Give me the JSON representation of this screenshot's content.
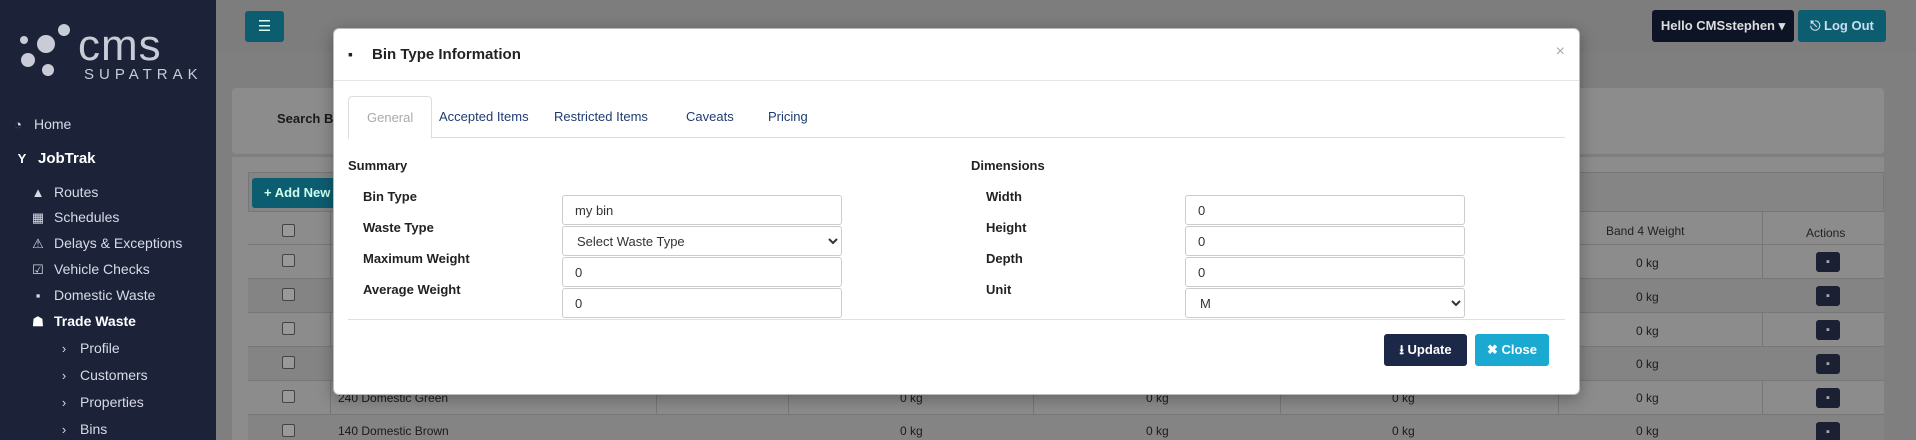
{
  "sidebar": {
    "logo_text": "cms",
    "logo_sub": "SUPATRAK",
    "items": [
      {
        "label": "Home",
        "icon": "dashboard-icon"
      },
      {
        "label": "JobTrak",
        "icon": "jobtrak-icon"
      },
      {
        "label": "Routes",
        "icon": "road-icon"
      },
      {
        "label": "Schedules",
        "icon": "calendar-icon"
      },
      {
        "label": "Delays & Exceptions",
        "icon": "warning-icon"
      },
      {
        "label": "Vehicle Checks",
        "icon": "check-square-icon"
      },
      {
        "label": "Domestic Waste",
        "icon": "bin-icon"
      },
      {
        "label": "Trade Waste",
        "icon": "users-icon"
      },
      {
        "label": "Profile",
        "icon": "chevron-right-icon"
      },
      {
        "label": "Customers",
        "icon": "chevron-right-icon"
      },
      {
        "label": "Properties",
        "icon": "chevron-right-icon"
      },
      {
        "label": "Bins",
        "icon": "chevron-right-icon"
      }
    ]
  },
  "header": {
    "menu_icon": "hamburger-icon",
    "user_label": "Hello CMSstephen",
    "logout_label": "Log Out"
  },
  "page": {
    "search_label": "Search Bi",
    "add_new_label": "Add New",
    "col_band4_weight": "Band 4 Weight",
    "col_actions": "Actions",
    "rows": [
      {
        "name": "",
        "w1": "",
        "w2": "",
        "w3": "",
        "w4": "0 kg"
      },
      {
        "name": "",
        "w1": "",
        "w2": "",
        "w3": "",
        "w4": "0 kg"
      },
      {
        "name": "",
        "w1": "",
        "w2": "",
        "w3": "",
        "w4": "0 kg"
      },
      {
        "name": "",
        "w1": "",
        "w2": "",
        "w3": "",
        "w4": "0 kg"
      },
      {
        "name": "240 Domestic Green",
        "w1": "0 kg",
        "w2": "0 kg",
        "w3": "0 kg",
        "w4": "0 kg"
      },
      {
        "name": "140 Domestic Brown",
        "w1": "0 kg",
        "w2": "0 kg",
        "w3": "0 kg",
        "w4": "0 kg"
      }
    ]
  },
  "modal": {
    "title": "Bin Type Information",
    "close_x": "×",
    "tabs": [
      "General",
      "Accepted Items",
      "Restricted Items",
      "Caveats",
      "Pricing"
    ],
    "active_tab": "General",
    "summary": {
      "heading": "Summary",
      "bin_type_label": "Bin Type",
      "bin_type_value": "my bin",
      "waste_type_label": "Waste Type",
      "waste_type_value": "Select Waste Type",
      "max_weight_label": "Maximum Weight",
      "max_weight_value": "0",
      "avg_weight_label": "Average Weight",
      "avg_weight_value": "0"
    },
    "dimensions": {
      "heading": "Dimensions",
      "width_label": "Width",
      "width_value": "0",
      "height_label": "Height",
      "height_value": "0",
      "depth_label": "Depth",
      "depth_value": "0",
      "unit_label": "Unit",
      "unit_value": "M"
    },
    "update_label": "Update",
    "close_label": "Close"
  }
}
